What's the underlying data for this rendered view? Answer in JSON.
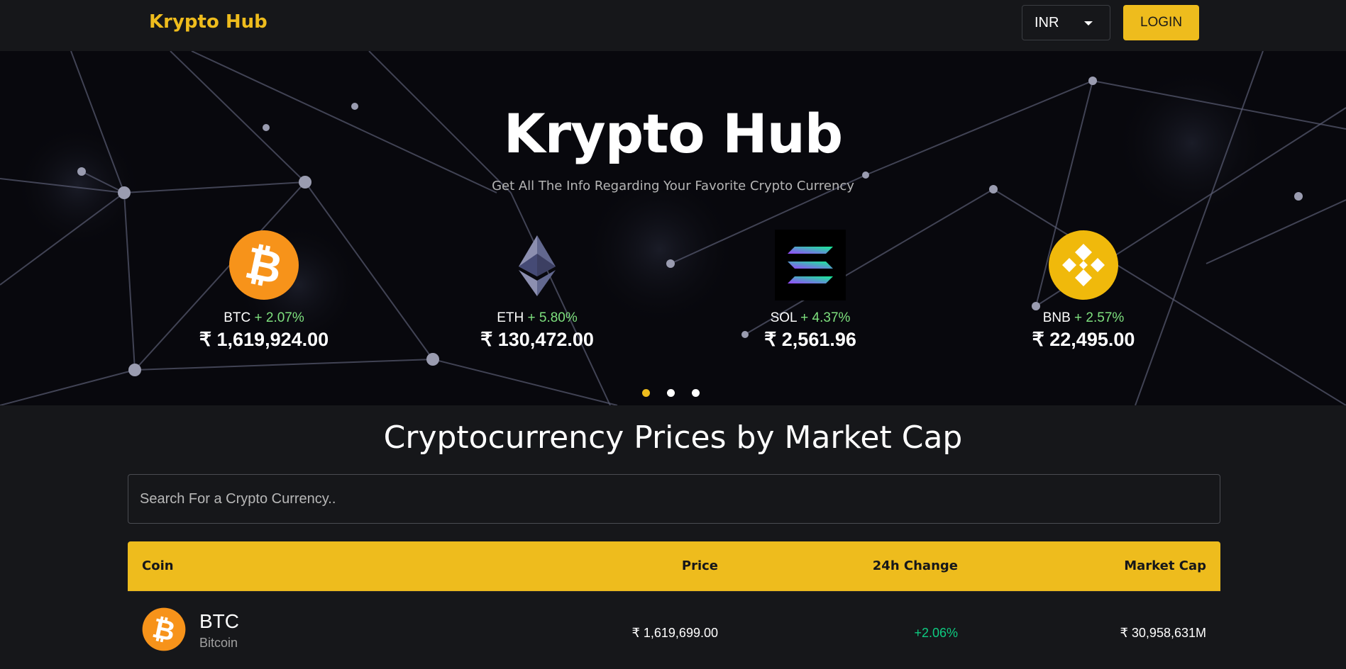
{
  "header": {
    "brand": "Krypto Hub",
    "currency": "INR",
    "login_label": "LOGIN"
  },
  "hero": {
    "title": "Krypto Hub",
    "subtitle": "Get All The Info Regarding Your Favorite Crypto Currency"
  },
  "carousel": [
    {
      "symbol": "BTC",
      "change": "+ 2.07%",
      "price": "₹ 1,619,924.00",
      "icon": "bitcoin-icon"
    },
    {
      "symbol": "ETH",
      "change": "+ 5.80%",
      "price": "₹ 130,472.00",
      "icon": "ethereum-icon"
    },
    {
      "symbol": "SOL",
      "change": "+ 4.37%",
      "price": "₹ 2,561.96",
      "icon": "solana-icon"
    },
    {
      "symbol": "BNB",
      "change": "+ 2.57%",
      "price": "₹ 22,495.00",
      "icon": "bnb-icon"
    }
  ],
  "market": {
    "title": "Cryptocurrency Prices by Market Cap",
    "search_placeholder": "Search For a Crypto Currency..",
    "columns": {
      "coin": "Coin",
      "price": "Price",
      "change": "24h Change",
      "cap": "Market Cap"
    },
    "rows": [
      {
        "symbol": "BTC",
        "name": "Bitcoin",
        "price": "₹ 1,619,699.00",
        "change": "+2.06%",
        "market_cap": "₹ 30,958,631M"
      }
    ]
  },
  "colors": {
    "accent": "#EEBC1D",
    "positive": "#0ecb81",
    "background": "#16171a"
  }
}
